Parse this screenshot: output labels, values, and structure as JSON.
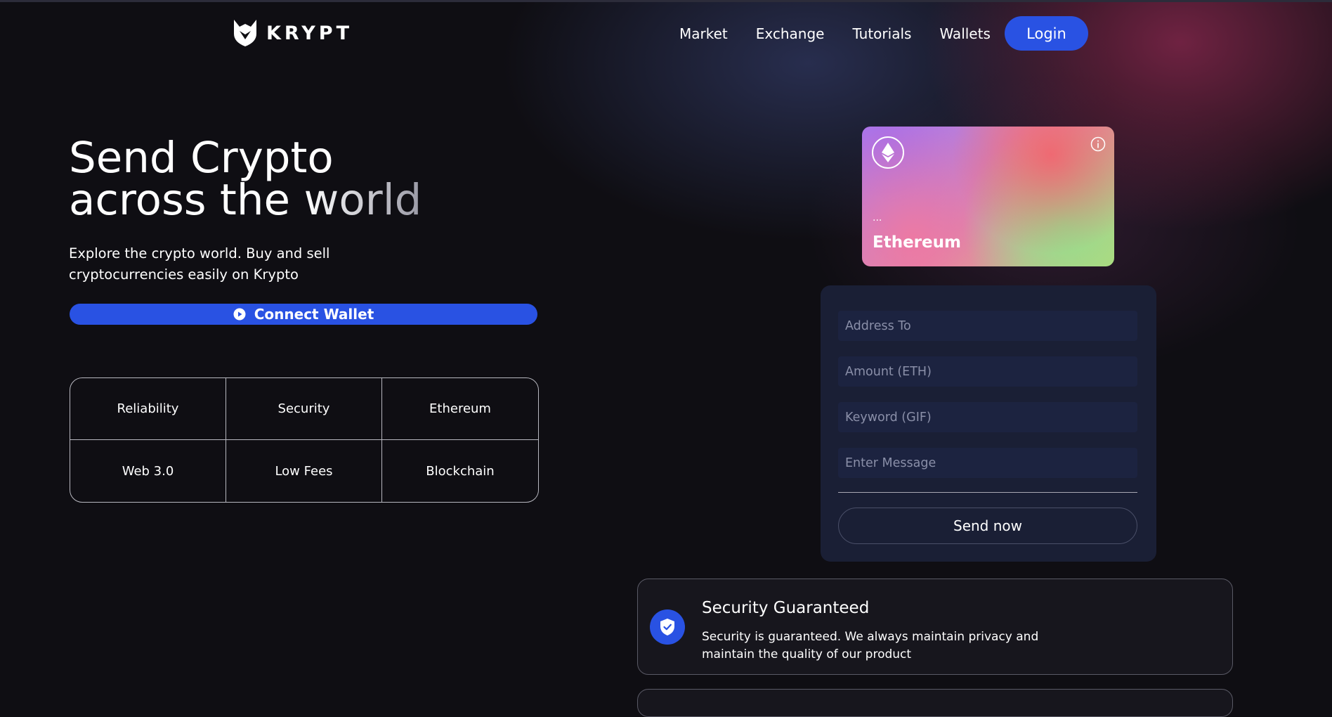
{
  "brand": {
    "name": "KRYPT"
  },
  "nav": {
    "items": [
      {
        "label": "Market"
      },
      {
        "label": "Exchange"
      },
      {
        "label": "Tutorials"
      },
      {
        "label": "Wallets"
      }
    ],
    "login_label": "Login"
  },
  "hero": {
    "title_line1": "Send Crypto",
    "title_line2_a": "across the ",
    "title_line2_b": "world",
    "subtitle": "Explore the crypto world. Buy and sell cryptocurrencies easily on Krypto",
    "connect_label": "Connect Wallet"
  },
  "features": [
    {
      "label": "Reliability"
    },
    {
      "label": "Security"
    },
    {
      "label": "Ethereum"
    },
    {
      "label": "Web 3.0"
    },
    {
      "label": "Low Fees"
    },
    {
      "label": "Blockchain"
    }
  ],
  "card": {
    "address_placeholder": "...",
    "network": "Ethereum"
  },
  "form": {
    "address_placeholder": "Address To",
    "amount_placeholder": "Amount (ETH)",
    "keyword_placeholder": "Keyword (GIF)",
    "message_placeholder": "Enter Message",
    "send_label": "Send now"
  },
  "service": {
    "title": "Security Guaranteed",
    "description": "Security is guaranteed. We always maintain privacy and maintain the quality of our product"
  },
  "colors": {
    "accent": "#2952e3",
    "background": "#0f0e13",
    "panel": "#1a1f35"
  },
  "icons": [
    "krypt-logo-icon",
    "play-icon",
    "ethereum-icon",
    "info-icon",
    "shield-check-icon"
  ]
}
